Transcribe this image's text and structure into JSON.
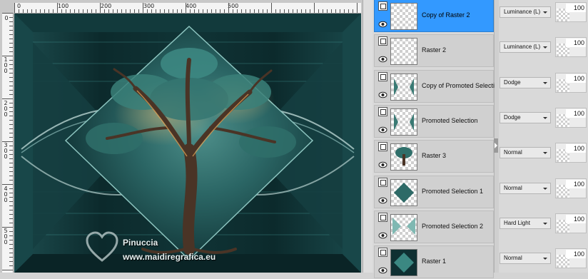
{
  "ruler": {
    "top_labels": [
      "0",
      "100",
      "200",
      "300",
      "400",
      "500"
    ],
    "left_labels": [
      "0",
      "1 0 0",
      "2 0 0",
      "3 0 0",
      "4 0 0",
      "5 0 0"
    ]
  },
  "watermark": {
    "line1": "Pinuccia",
    "line2": "www.maidiregrafica.eu"
  },
  "layers": [
    {
      "name": "Copy of Raster 2",
      "blend": "Luminance (L)",
      "opacity": "100",
      "selected": true
    },
    {
      "name": "Raster 2",
      "blend": "Luminance (L)",
      "opacity": "100",
      "selected": false
    },
    {
      "name": "Copy of Promoted Selection",
      "blend": "Dodge",
      "opacity": "100",
      "selected": false
    },
    {
      "name": "Promoted Selection",
      "blend": "Dodge",
      "opacity": "100",
      "selected": false
    },
    {
      "name": "Raster 3",
      "blend": "Normal",
      "opacity": "100",
      "selected": false
    },
    {
      "name": "Promoted Selection 1",
      "blend": "Normal",
      "opacity": "100",
      "selected": false
    },
    {
      "name": "Promoted Selection 2",
      "blend": "Hard Light",
      "opacity": "100",
      "selected": false
    },
    {
      "name": "Raster 1",
      "blend": "Normal",
      "opacity": "100",
      "selected": false
    }
  ],
  "colors": {
    "selected_row": "#3399ff",
    "teal_dark": "#0d2a2a",
    "teal": "#2e7c7a",
    "bark": "#4a3426"
  }
}
